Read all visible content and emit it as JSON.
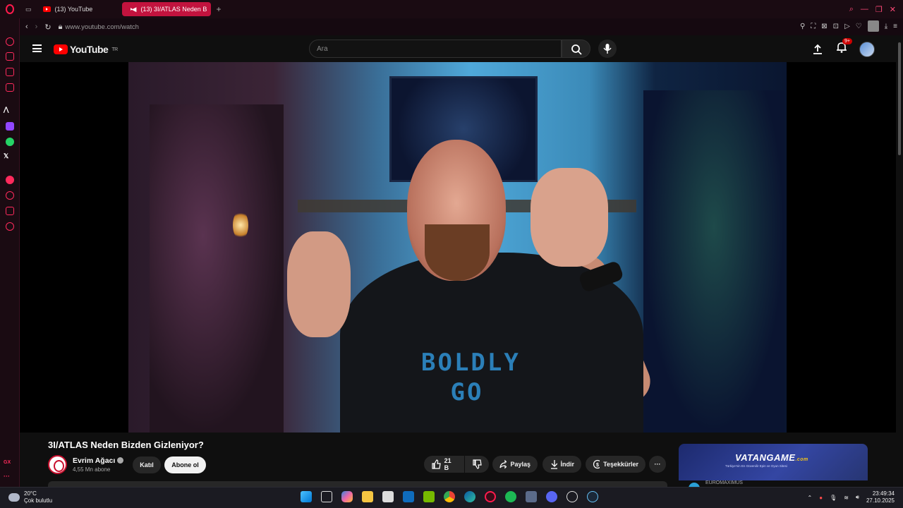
{
  "browser": {
    "tabs": [
      {
        "label": "(13) YouTube",
        "active": false
      },
      {
        "label": "(13) 3I/ATLAS Neden B",
        "active": true
      }
    ],
    "url": "www.youtube.com/watch",
    "sidebar_text": "GX"
  },
  "youtube": {
    "logo": "YouTube",
    "region": "TR",
    "search_placeholder": "Ara",
    "notification_count": "9+"
  },
  "video": {
    "shirt_text": "BOLDLY GO",
    "title": "3I/ATLAS Neden Bizden Gizleniyor?",
    "channel": "Evrim Ağacı",
    "subscribers": "4,55 Mn abone",
    "join_label": "Katıl",
    "subscribe_label": "Abone ol",
    "likes": "21 B",
    "share_label": "Paylaş",
    "download_label": "İndir",
    "thanks_label": "Teşekkürler"
  },
  "ad": {
    "brand": "VATANGAME",
    "brand_suffix": ".com",
    "tagline": "Türkiye'nin En Güvenilir Epin ve Oyun Sitesi",
    "caption": "EUROMAXIMUS"
  },
  "taskbar": {
    "temperature": "20°C",
    "weather": "Çok bulutlu",
    "time": "23:49:34",
    "date": "27.10.2025"
  },
  "colors": {
    "accent": "#ff1b4d",
    "youtube_red": "#ff0000",
    "background": "#0f0f0f"
  }
}
